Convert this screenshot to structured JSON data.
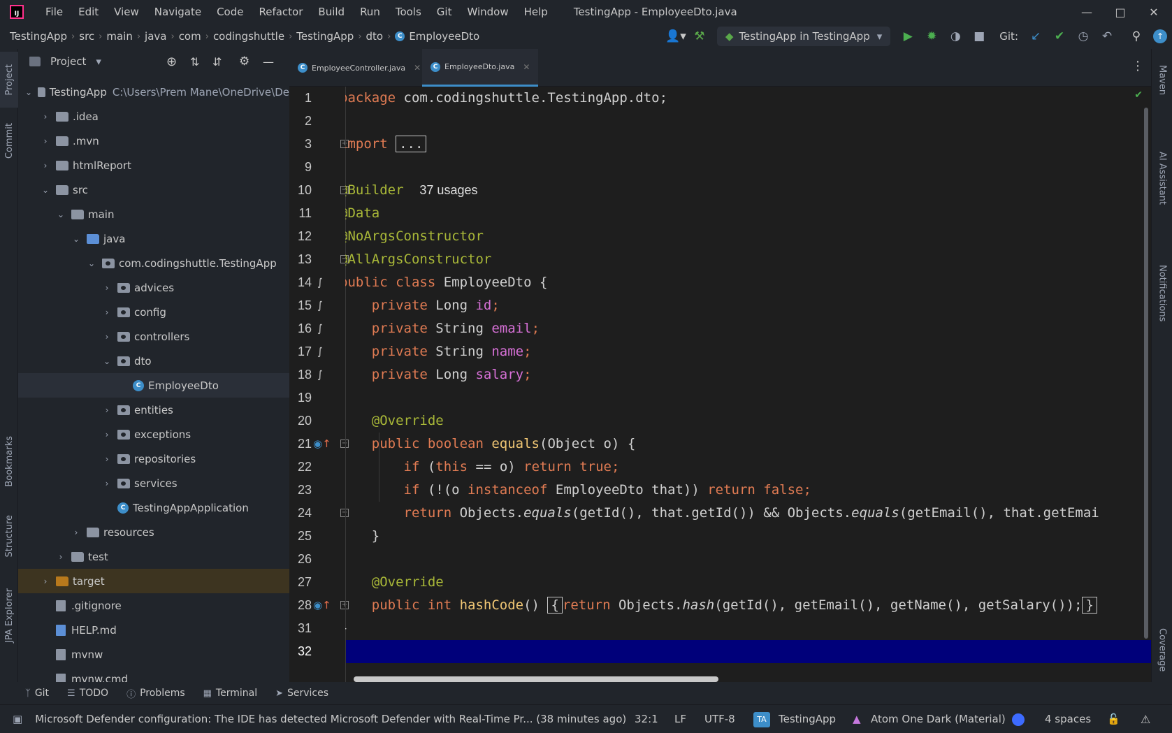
{
  "window": {
    "title": "TestingApp - EmployeeDto.java",
    "menu": [
      "File",
      "Edit",
      "View",
      "Navigate",
      "Code",
      "Refactor",
      "Build",
      "Run",
      "Tools",
      "Git",
      "Window",
      "Help"
    ]
  },
  "breadcrumb": [
    "TestingApp",
    "src",
    "main",
    "java",
    "com",
    "codingshuttle",
    "TestingApp",
    "dto",
    "EmployeeDto"
  ],
  "toolbar": {
    "run_config": "TestingApp in TestingApp",
    "git_label": "Git:"
  },
  "project_panel": {
    "title": "Project",
    "tree": [
      {
        "label": "TestingApp",
        "extra": "C:\\Users\\Prem Mane\\OneDrive\\De"
      },
      {
        "label": ".idea"
      },
      {
        "label": ".mvn"
      },
      {
        "label": "htmlReport"
      },
      {
        "label": "src"
      },
      {
        "label": "main"
      },
      {
        "label": "java"
      },
      {
        "label": "com.codingshuttle.TestingApp"
      },
      {
        "label": "advices"
      },
      {
        "label": "config"
      },
      {
        "label": "controllers"
      },
      {
        "label": "dto"
      },
      {
        "label": "EmployeeDto"
      },
      {
        "label": "entities"
      },
      {
        "label": "exceptions"
      },
      {
        "label": "repositories"
      },
      {
        "label": "services"
      },
      {
        "label": "TestingAppApplication"
      },
      {
        "label": "resources"
      },
      {
        "label": "test"
      },
      {
        "label": "target"
      },
      {
        "label": ".gitignore"
      },
      {
        "label": "HELP.md"
      },
      {
        "label": "mvnw"
      },
      {
        "label": "mvnw.cmd"
      }
    ]
  },
  "left_tabs": [
    "Project",
    "Commit",
    "Bookmarks",
    "Structure",
    "JPA Explorer"
  ],
  "right_tabs": [
    "Maven",
    "AI Assistant",
    "Notifications",
    "Coverage"
  ],
  "editor": {
    "tabs": [
      {
        "label": "EmployeeController.java",
        "active": false
      },
      {
        "label": "EmployeeDto.java",
        "active": true
      }
    ],
    "line_numbers": [
      "1",
      "2",
      "3",
      "9",
      "10",
      "11",
      "12",
      "13",
      "14",
      "15",
      "16",
      "17",
      "18",
      "19",
      "20",
      "21",
      "22",
      "23",
      "24",
      "25",
      "26",
      "27",
      "28",
      "31",
      "32"
    ],
    "code": {
      "l1_kw": "package",
      "l1_rest": " com.codingshuttle.TestingApp.dto;",
      "l3_kw": "import",
      "l3_fold": "...",
      "l10_ann": "@Builder",
      "l10_hint": "37 usages",
      "l11_ann": "@Data",
      "l12_ann": "@NoArgsConstructor",
      "l13_ann": "@AllArgsConstructor",
      "l14_kw": "public class",
      "l14_name": " EmployeeDto {",
      "l15_kw": "private",
      "l15_type": " Long ",
      "l15_field": "id",
      "l15_end": ";",
      "l16_kw": "private",
      "l16_type": " String ",
      "l16_field": "email",
      "l16_end": ";",
      "l17_kw": "private",
      "l17_type": " String ",
      "l17_field": "name",
      "l17_end": ";",
      "l18_kw": "private",
      "l18_type": " Long ",
      "l18_field": "salary",
      "l18_end": ";",
      "l20_ann": "@Override",
      "l21_kw": "public boolean",
      "l21_mth": " equals",
      "l21_rest": "(Object o) {",
      "l22_kw1": "if",
      "l22_a": " (",
      "l22_kw2": "this",
      "l22_b": " == o) ",
      "l22_kw3": "return true",
      "l22_end": ";",
      "l23_kw1": "if",
      "l23_a": " (!(o ",
      "l23_kw2": "instanceof",
      "l23_b": " EmployeeDto that)) ",
      "l23_kw3": "return false",
      "l23_end": ";",
      "l24_kw": "return",
      "l24_a": " Objects.",
      "l24_eq1": "equals",
      "l24_b": "(getId(), that.getId()) && Objects.",
      "l24_eq2": "equals",
      "l24_c": "(getEmail(), that.getEmai",
      "l25": "}",
      "l27_ann": "@Override",
      "l28_kw": "public int",
      "l28_mth": " hashCode",
      "l28_a": "() ",
      "l28_brace": "{",
      "l28_kw2": "return",
      "l28_b": " Objects.",
      "l28_hash": "hash",
      "l28_c": "(getId(), getEmail(), getName(), getSalary());",
      "l28_close": "}",
      "l31": "}"
    }
  },
  "bottom_tools": [
    "Git",
    "TODO",
    "Problems",
    "Terminal",
    "Services"
  ],
  "status": {
    "message": "Microsoft Defender configuration: The IDE has detected Microsoft Defender with Real-Time Pr... (38 minutes ago)",
    "position": "32:1",
    "line_sep": "LF",
    "encoding": "UTF-8",
    "project_badge": "TA",
    "project": "TestingApp",
    "theme": "Atom One Dark (Material)",
    "indent": "4 spaces"
  }
}
